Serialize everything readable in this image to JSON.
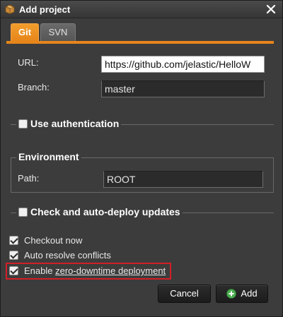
{
  "window": {
    "title": "Add project"
  },
  "tabs": [
    {
      "label": "Git",
      "active": true
    },
    {
      "label": "SVN",
      "active": false
    }
  ],
  "form": {
    "url": {
      "label": "URL:",
      "value": "https://github.com/jelastic/HelloW"
    },
    "branch": {
      "label": "Branch:",
      "value": "master"
    }
  },
  "auth": {
    "label": "Use authentication",
    "checked": false
  },
  "environment": {
    "title": "Environment",
    "path_label": "Path:",
    "path_value": "ROOT"
  },
  "autodeploy": {
    "label": "Check and auto-deploy updates",
    "checked": false
  },
  "options": [
    {
      "label": "Checkout now",
      "checked": true
    },
    {
      "label": "Auto resolve conflicts",
      "checked": true
    },
    {
      "label_prefix": "Enable ",
      "label_link": "zero-downtime deployment",
      "checked": true
    }
  ],
  "buttons": {
    "cancel": "Cancel",
    "add": "Add"
  },
  "colors": {
    "accent": "#e6851a",
    "highlight": "#d21f27",
    "add_icon": "#4caf50"
  }
}
